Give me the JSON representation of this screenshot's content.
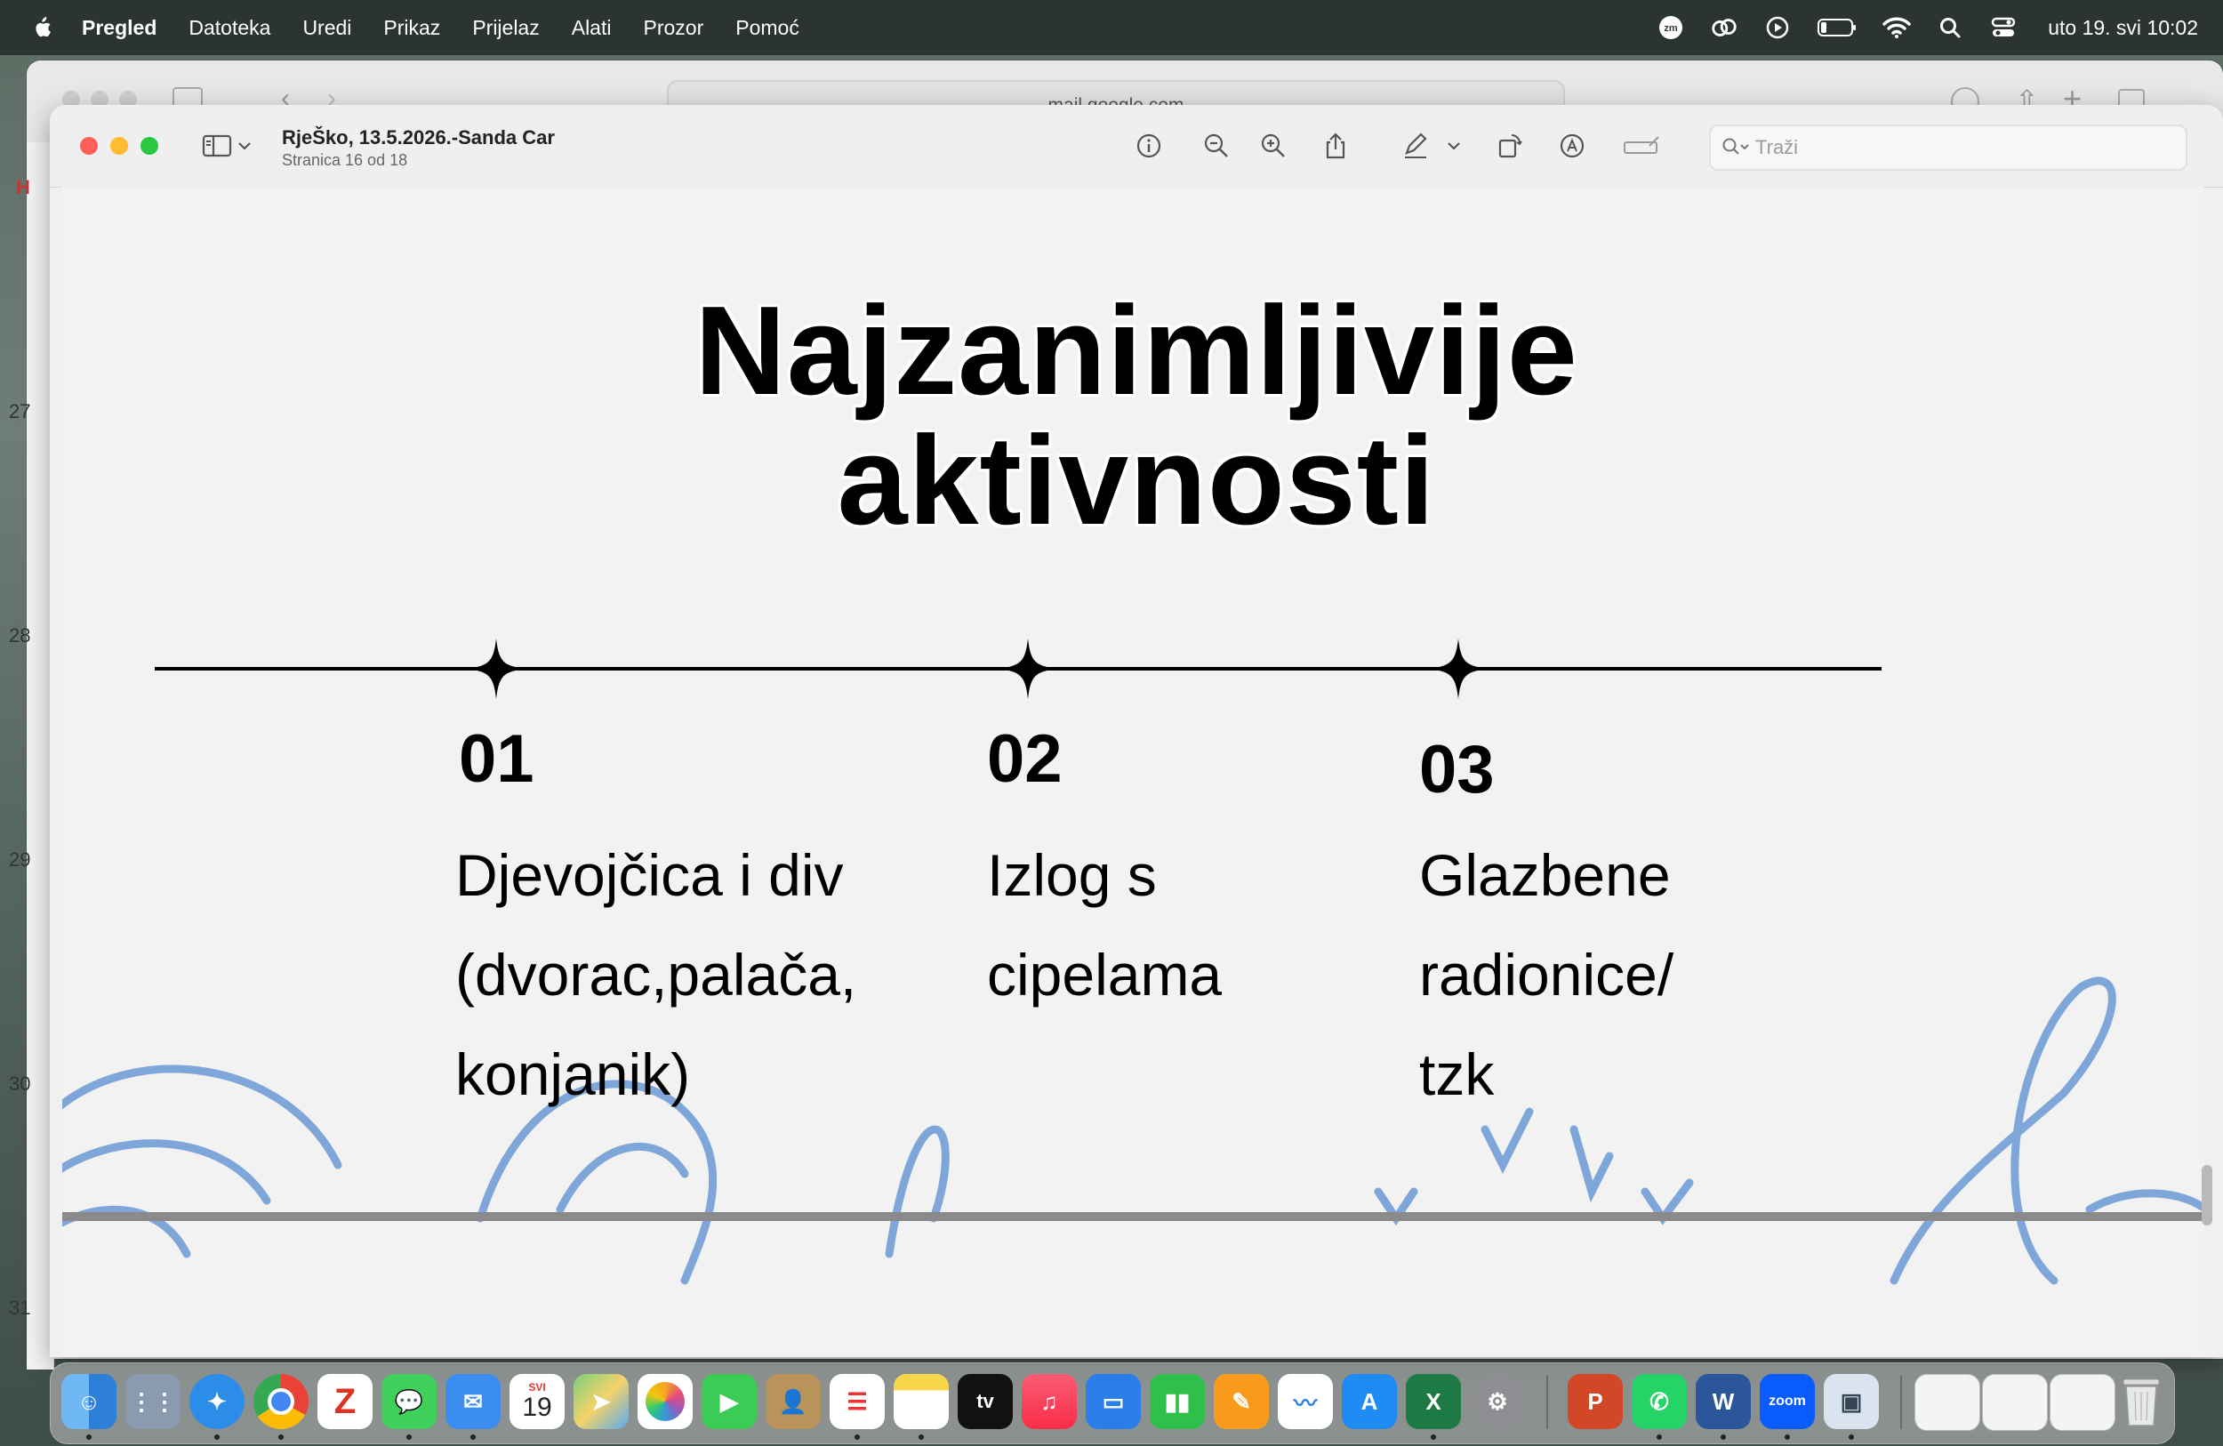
{
  "menubar": {
    "app": "Pregled",
    "items": [
      "Datoteka",
      "Uredi",
      "Prikaz",
      "Prijelaz",
      "Alati",
      "Prozor",
      "Pomoć"
    ],
    "clock": "uto 19. svi  10:02",
    "status_icons": [
      "zoom-icon",
      "creative-cloud-icon",
      "play-icon",
      "battery-icon",
      "wifi-icon",
      "spotlight-icon",
      "control-center-icon"
    ]
  },
  "background_window": {
    "url": "mail.google.com",
    "sidebar_numbers": [
      "27",
      "28",
      "29",
      "30",
      "31"
    ],
    "sidebar_letter": "H"
  },
  "preview": {
    "title": "RjeŠko, 13.5.2026.-Sanda Car",
    "subtitle": "Stranica 16 od 18",
    "search_placeholder": "Traži",
    "toolbar_icons": [
      "info-icon",
      "zoom-out-icon",
      "zoom-in-icon",
      "share-icon",
      "markup-pen-icon",
      "chevron-down-icon",
      "rotate-icon",
      "annotate-icon",
      "highlight-icon"
    ]
  },
  "slide": {
    "title_line1": "Najzanimljivije",
    "title_line2": "aktivnosti",
    "columns": [
      {
        "number": "01",
        "lines": [
          "Djevojčica i div",
          "(dvorac,palača,",
          "konjanik)"
        ]
      },
      {
        "number": "02",
        "lines": [
          "Izlog s",
          "cipelama"
        ]
      },
      {
        "number": "03",
        "lines": [
          "Glazbene",
          "radionice/",
          "tzk"
        ]
      }
    ],
    "accent_color": "#7ea6d8"
  },
  "dock": {
    "calendar_month": "SVI",
    "calendar_day": "19",
    "apps": [
      "Finder",
      "Launchpad",
      "Safari",
      "Chrome",
      "Zotero",
      "Messages",
      "Mail",
      "Calendar",
      "Maps",
      "Photos",
      "FaceTime",
      "Contacts",
      "Reminders",
      "Notes",
      "TV",
      "Music",
      "Keynote",
      "Numbers",
      "Pages",
      "Freeform",
      "App Store",
      "Excel",
      "System Settings",
      "PowerPoint",
      "WhatsApp",
      "Word",
      "Zoom",
      "Preview"
    ],
    "tv_label": "tv",
    "zoom_label": "zoom"
  }
}
